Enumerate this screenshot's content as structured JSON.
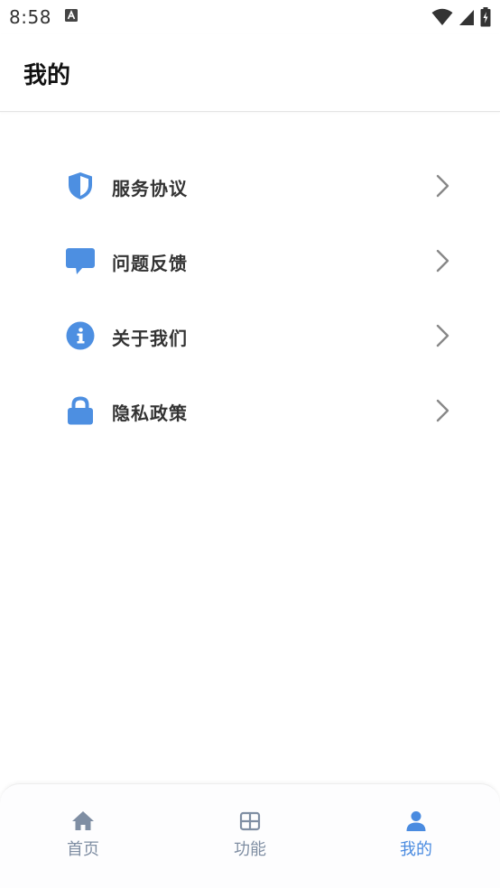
{
  "status_bar": {
    "time": "8:58",
    "notification_icon": "a-letter-icon",
    "right_icons": [
      "wifi-icon",
      "cellular-signal-icon",
      "battery-charging-icon"
    ]
  },
  "header": {
    "title": "我的"
  },
  "menu": {
    "items": [
      {
        "label": "服务协议",
        "icon": "shield-icon"
      },
      {
        "label": "问题反馈",
        "icon": "chat-bubble-icon"
      },
      {
        "label": "关于我们",
        "icon": "info-icon"
      },
      {
        "label": "隐私政策",
        "icon": "lock-icon"
      }
    ],
    "trailing_icon": "chevron-right-icon"
  },
  "tab_bar": {
    "tabs": [
      {
        "label": "首页",
        "icon": "home-icon",
        "active": false
      },
      {
        "label": "功能",
        "icon": "grid-icon",
        "active": false
      },
      {
        "label": "我的",
        "icon": "person-icon",
        "active": true
      }
    ]
  },
  "colors": {
    "accent": "#4a8be0",
    "icon_blue": "#4d8fe1",
    "tab_inactive": "#7f8ea3",
    "chevron": "#888888",
    "text_primary": "#333333"
  }
}
